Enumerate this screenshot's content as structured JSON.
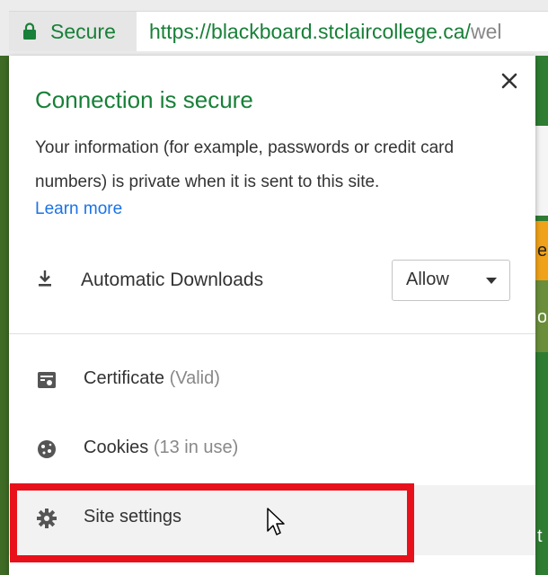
{
  "address_bar": {
    "secure_label": "Secure",
    "url_host": "https://blackboard.stclaircollege.ca/",
    "url_rest": "wel"
  },
  "background_fragments": [
    "es",
    "o",
    "t"
  ],
  "popup": {
    "title": "Connection is secure",
    "description": "Your information (for example, passwords or credit card numbers) is private when it is sent to this site.",
    "learn_more": "Learn more",
    "permission": {
      "label": "Automatic Downloads",
      "icon": "download-icon",
      "value": "Allow"
    },
    "items": [
      {
        "label": "Certificate",
        "detail": "(Valid)",
        "icon": "certificate-icon"
      },
      {
        "label": "Cookies",
        "detail": "(13 in use)",
        "icon": "cookie-icon"
      },
      {
        "label": "Site settings",
        "detail": "",
        "icon": "gear-icon"
      }
    ]
  },
  "colors": {
    "secure_green": "#188038",
    "link_blue": "#1a73e8",
    "highlight_red": "#e8111b"
  }
}
